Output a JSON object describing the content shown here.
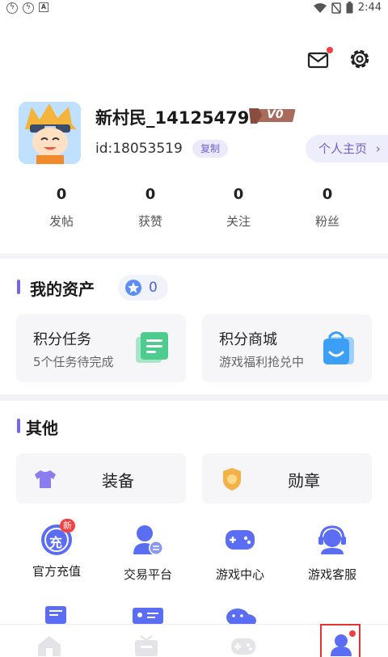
{
  "status_bar": {
    "time": "2:44"
  },
  "header": {
    "username": "新村民_14125479",
    "level_badge": "V0",
    "user_id": "id:18053519",
    "copy_label": "复制",
    "homepage_label": "个人主页",
    "stats": [
      {
        "count": "0",
        "label": "发帖"
      },
      {
        "count": "0",
        "label": "获赞"
      },
      {
        "count": "0",
        "label": "关注"
      },
      {
        "count": "0",
        "label": "粉丝"
      }
    ]
  },
  "assets": {
    "title": "我的资产",
    "points": "0",
    "cards": [
      {
        "title": "积分任务",
        "subtitle": "5个任务待完成",
        "icon": "task-list-icon"
      },
      {
        "title": "积分商城",
        "subtitle": "游戏福利抢兑中",
        "icon": "shopping-bag-icon"
      }
    ]
  },
  "other": {
    "title": "其他",
    "wide_buttons": [
      {
        "label": "装备",
        "icon": "tshirt-icon"
      },
      {
        "label": "勋章",
        "icon": "medal-icon"
      }
    ],
    "grid": [
      {
        "label": "官方充值",
        "icon": "recharge-icon",
        "icon_text": "充",
        "badge": "新"
      },
      {
        "label": "交易平台",
        "icon": "trade-user-icon"
      },
      {
        "label": "游戏中心",
        "icon": "gamepad-icon"
      },
      {
        "label": "游戏客服",
        "icon": "headset-icon"
      }
    ]
  },
  "colors": {
    "accent": "#7466f0",
    "notify": "#f04040",
    "icon_blue": "#5b6df2"
  }
}
